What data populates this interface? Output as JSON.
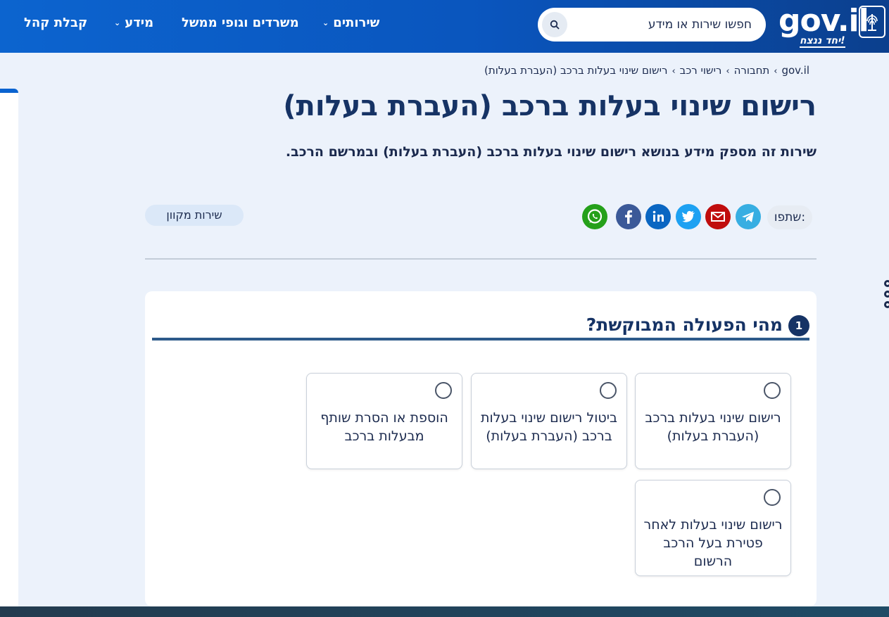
{
  "header": {
    "logo_text": "gov.il",
    "logo_tagline": "יחד ננצח!",
    "search_placeholder": "חפשו שירות או מידע",
    "nav": [
      {
        "label": "שירותים",
        "has_dropdown": true
      },
      {
        "label": "משרדים וגופי ממשל",
        "has_dropdown": false
      },
      {
        "label": "מידע",
        "has_dropdown": true
      },
      {
        "label": "קבלת קהל",
        "has_dropdown": false
      }
    ],
    "chevron": "⌄"
  },
  "breadcrumb": {
    "items": [
      "gov.il",
      "תחבורה",
      "רישוי רכב",
      "רישום שינוי בעלות ברכב (העברת בעלות)"
    ],
    "separator": "›"
  },
  "page": {
    "title": "רישום שינוי בעלות ברכב (העברת בעלות)",
    "subtitle": "שירות זה מספק מידע בנושא רישום שינוי בעלות ברכב (העברת בעלות)  ובמרשם הרכב."
  },
  "share": {
    "label": "שתפו:",
    "icons": [
      {
        "name": "telegram-icon",
        "color": "#37aee2"
      },
      {
        "name": "email-icon",
        "color": "#c00d0d"
      },
      {
        "name": "twitter-icon",
        "color": "#1da1f2"
      },
      {
        "name": "linkedin-icon",
        "color": "#0a66c2"
      },
      {
        "name": "facebook-icon",
        "color": "#3b5998"
      },
      {
        "name": "whatsapp-icon",
        "color": "#25a01a"
      }
    ]
  },
  "badge": {
    "online_service": "שירות מקוון"
  },
  "question": {
    "number": "1",
    "text": "מהי הפעולה המבוקשת?",
    "options": [
      {
        "label": "רישום שינוי בעלות ברכב (העברת בעלות)",
        "selected": false
      },
      {
        "label": "ביטול רישום שינוי בעלות ברכב (העברת בעלות)",
        "selected": false
      },
      {
        "label": "הוספת או הסרת שותף מבעלות ברכב",
        "selected": false
      },
      {
        "label": "רישום שינוי בעלות לאחר פטירת בעל הרכב הרשום",
        "selected": false
      }
    ]
  },
  "colors": {
    "header_blue": "#0a55bd",
    "title_navy": "#163365",
    "page_bg": "#ecf2fb"
  }
}
